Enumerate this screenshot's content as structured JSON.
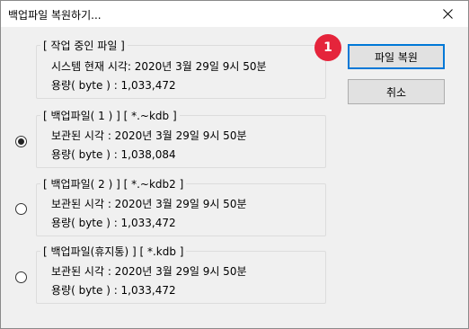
{
  "window": {
    "title": "백업파일 복원하기..."
  },
  "current": {
    "legend": "[ 작업 중인 파일 ]",
    "time_line": "시스템 현재 시각: 2020년 3월 29일 9시 50분",
    "size_line": "용량( byte ) : 1,033,472"
  },
  "backups": [
    {
      "legend": "[ 백업파일( 1 ) ]  [ *.~kdb ]",
      "time_line": "보관된 시각 : 2020년 3월 29일 9시 50분",
      "size_line": "용량( byte ) : 1,038,084",
      "selected": true
    },
    {
      "legend": "[ 백업파일( 2 ) ]  [ *.~kdb2 ]",
      "time_line": "보관된 시각 : 2020년 3월 29일 9시 50분",
      "size_line": "용량( byte ) : 1,033,472",
      "selected": false
    },
    {
      "legend": "[ 백업파일(휴지통) ]  [ *.kdb ]",
      "time_line": "보관된 시각 : 2020년 3월 29일 9시 50분",
      "size_line": "용량( byte ) : 1,033,472",
      "selected": false
    }
  ],
  "buttons": {
    "restore_label": "파일 복원",
    "cancel_label": "취소"
  },
  "badge": {
    "label": "1",
    "color": "#e5243b"
  },
  "colors": {
    "focus_border": "#0078d7",
    "dialog_bg": "#f0f0f0"
  }
}
